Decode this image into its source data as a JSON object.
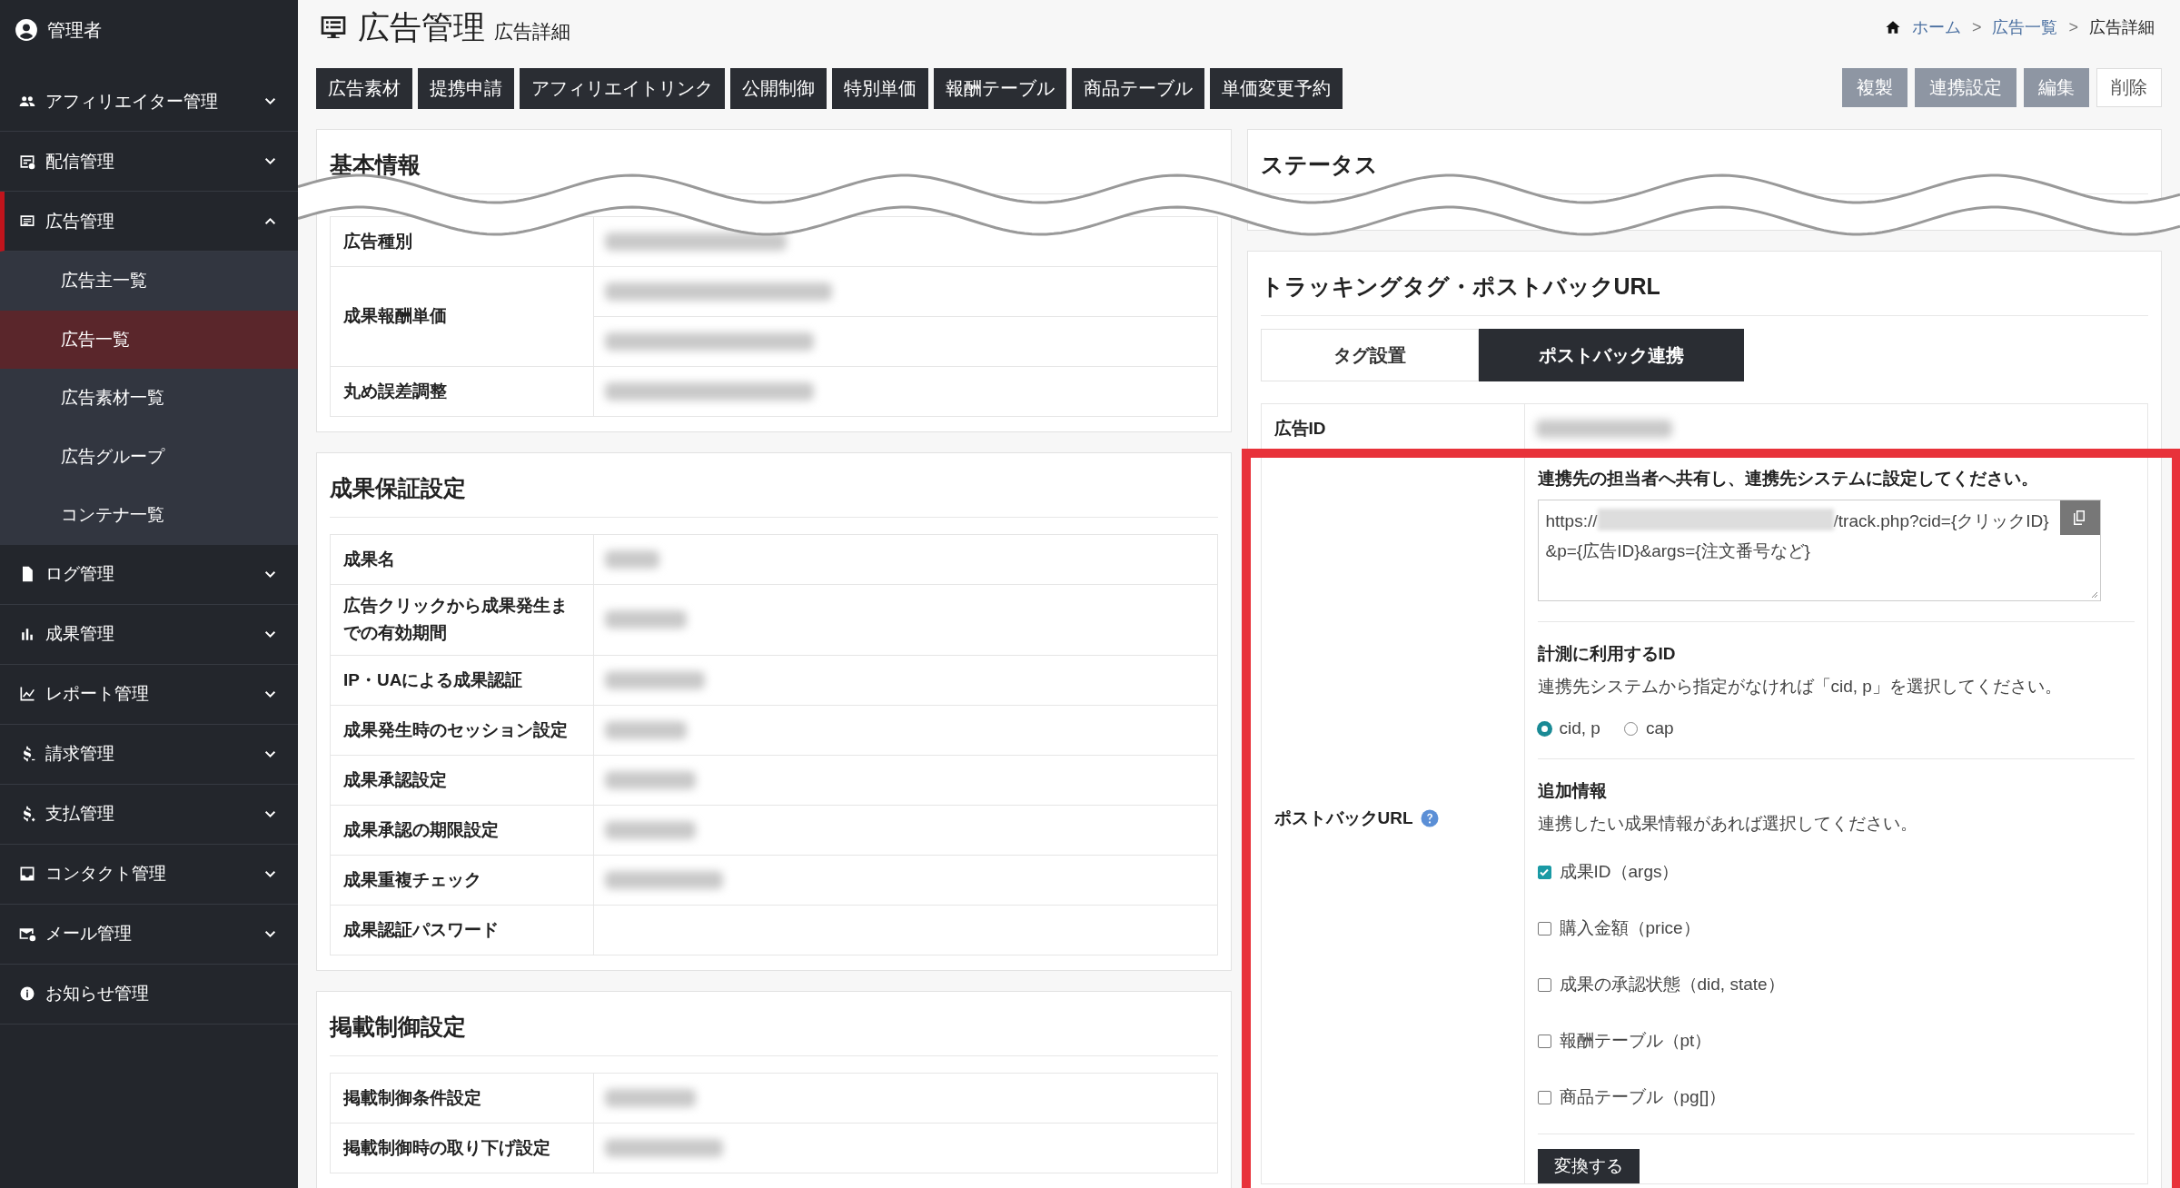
{
  "sidebar": {
    "user": "管理者",
    "items": [
      {
        "label": "アフィリエイター管理",
        "expanded": false
      },
      {
        "label": "配信管理",
        "expanded": false
      },
      {
        "label": "広告管理",
        "expanded": true,
        "children": [
          {
            "label": "広告主一覧",
            "selected": false
          },
          {
            "label": "広告一覧",
            "selected": true
          },
          {
            "label": "広告素材一覧",
            "selected": false
          },
          {
            "label": "広告グループ",
            "selected": false
          },
          {
            "label": "コンテナ一覧",
            "selected": false
          }
        ]
      },
      {
        "label": "ログ管理",
        "expanded": false
      },
      {
        "label": "成果管理",
        "expanded": false
      },
      {
        "label": "レポート管理",
        "expanded": false
      },
      {
        "label": "請求管理",
        "expanded": false
      },
      {
        "label": "支払管理",
        "expanded": false
      },
      {
        "label": "コンタクト管理",
        "expanded": false
      },
      {
        "label": "メール管理",
        "expanded": false
      },
      {
        "label": "お知らせ管理"
      }
    ]
  },
  "header": {
    "title": "広告管理",
    "subtitle": "広告詳細",
    "breadcrumb": [
      {
        "label": "ホーム",
        "kind": "link",
        "separator": ">"
      },
      {
        "label": "広告一覧",
        "kind": "link",
        "separator": ">"
      },
      {
        "label": "広告詳細",
        "kind": "current"
      }
    ]
  },
  "toolbar": {
    "tabs": [
      "広告素材",
      "提携申請",
      "アフィリエイトリンク",
      "公開制御",
      "特別単価",
      "報酬テーブル",
      "商品テーブル",
      "単価変更予約"
    ],
    "actions": [
      {
        "label": "複製",
        "kind": "secondary"
      },
      {
        "label": "連携設定",
        "kind": "secondary"
      },
      {
        "label": "編集",
        "kind": "secondary"
      },
      {
        "label": "削除",
        "kind": "outline"
      }
    ]
  },
  "cut_marker": true,
  "left_panels": [
    {
      "title": "基本情報",
      "rows": [
        {
          "label": "広告種別",
          "values": [
            {
              "redacted": true
            }
          ]
        },
        {
          "label": "成果報酬単価",
          "values": [
            {
              "redacted": true
            },
            {
              "redacted": true
            }
          ]
        },
        {
          "label": "丸め誤差調整",
          "values": [
            {
              "redacted": true
            }
          ]
        }
      ]
    },
    {
      "title": "成果保証設定",
      "rows": [
        {
          "label": "成果名",
          "values": [
            {
              "redacted": true
            }
          ]
        },
        {
          "label": "広告クリックから成果発生までの有効期間",
          "values": [
            {
              "redacted": true
            }
          ]
        },
        {
          "label": "IP・UAによる成果認証",
          "values": [
            {
              "redacted": true
            }
          ]
        },
        {
          "label": "成果発生時のセッション設定",
          "values": [
            {
              "redacted": true
            }
          ]
        },
        {
          "label": "成果承認設定",
          "values": [
            {
              "redacted": true
            }
          ]
        },
        {
          "label": "成果承認の期限設定",
          "values": [
            {
              "redacted": true
            }
          ]
        },
        {
          "label": "成果重複チェック",
          "values": [
            {
              "redacted": true
            }
          ]
        },
        {
          "label": "成果認証パスワード"
        }
      ]
    },
    {
      "title": "掲載制御設定",
      "rows": [
        {
          "label": "掲載制御条件設定",
          "values": [
            {
              "redacted": true
            }
          ]
        },
        {
          "label": "掲載制御時の取り下げ設定",
          "values": [
            {
              "redacted": true
            }
          ]
        }
      ]
    }
  ],
  "status_panel": {
    "title": "ステータス"
  },
  "tracking_panel": {
    "title": "トラッキングタグ・ポストバックURL",
    "tabs": [
      {
        "label": "タグ設置",
        "selected": false
      },
      {
        "label": "ポストバック連携",
        "selected": true
      }
    ],
    "rows": [
      {
        "label": "広告ID",
        "values": [
          {
            "redacted": true
          }
        ]
      }
    ],
    "postback": {
      "label": "ポストバックURL",
      "highlighted": true,
      "instruction": "連携先の担当者へ共有し、連携先システムに設定してください。",
      "url_prefix": "https://",
      "url_redacted": true,
      "url_suffix": "/track.php?cid={クリックID}&p={広告ID}&args={注文番号など}",
      "id_section": {
        "title": "計測に利用するID",
        "description": "連携先システムから指定がなければ「cid, p」を選択してください。",
        "options": [
          {
            "label": "cid, p",
            "selected": true
          },
          {
            "label": "cap",
            "selected": false
          }
        ]
      },
      "extra_section": {
        "title": "追加情報",
        "description": "連携したい成果情報があれば選択してください。",
        "options": [
          {
            "label": "成果ID（args）",
            "checked": true
          },
          {
            "label": "購入金額（price）",
            "checked": false
          },
          {
            "label": "成果の承認状態（did, state）",
            "checked": false
          },
          {
            "label": "報酬テーブル（pt）",
            "checked": false
          },
          {
            "label": "商品テーブル（pg[]）",
            "checked": false
          }
        ]
      },
      "button": "変換する"
    }
  }
}
